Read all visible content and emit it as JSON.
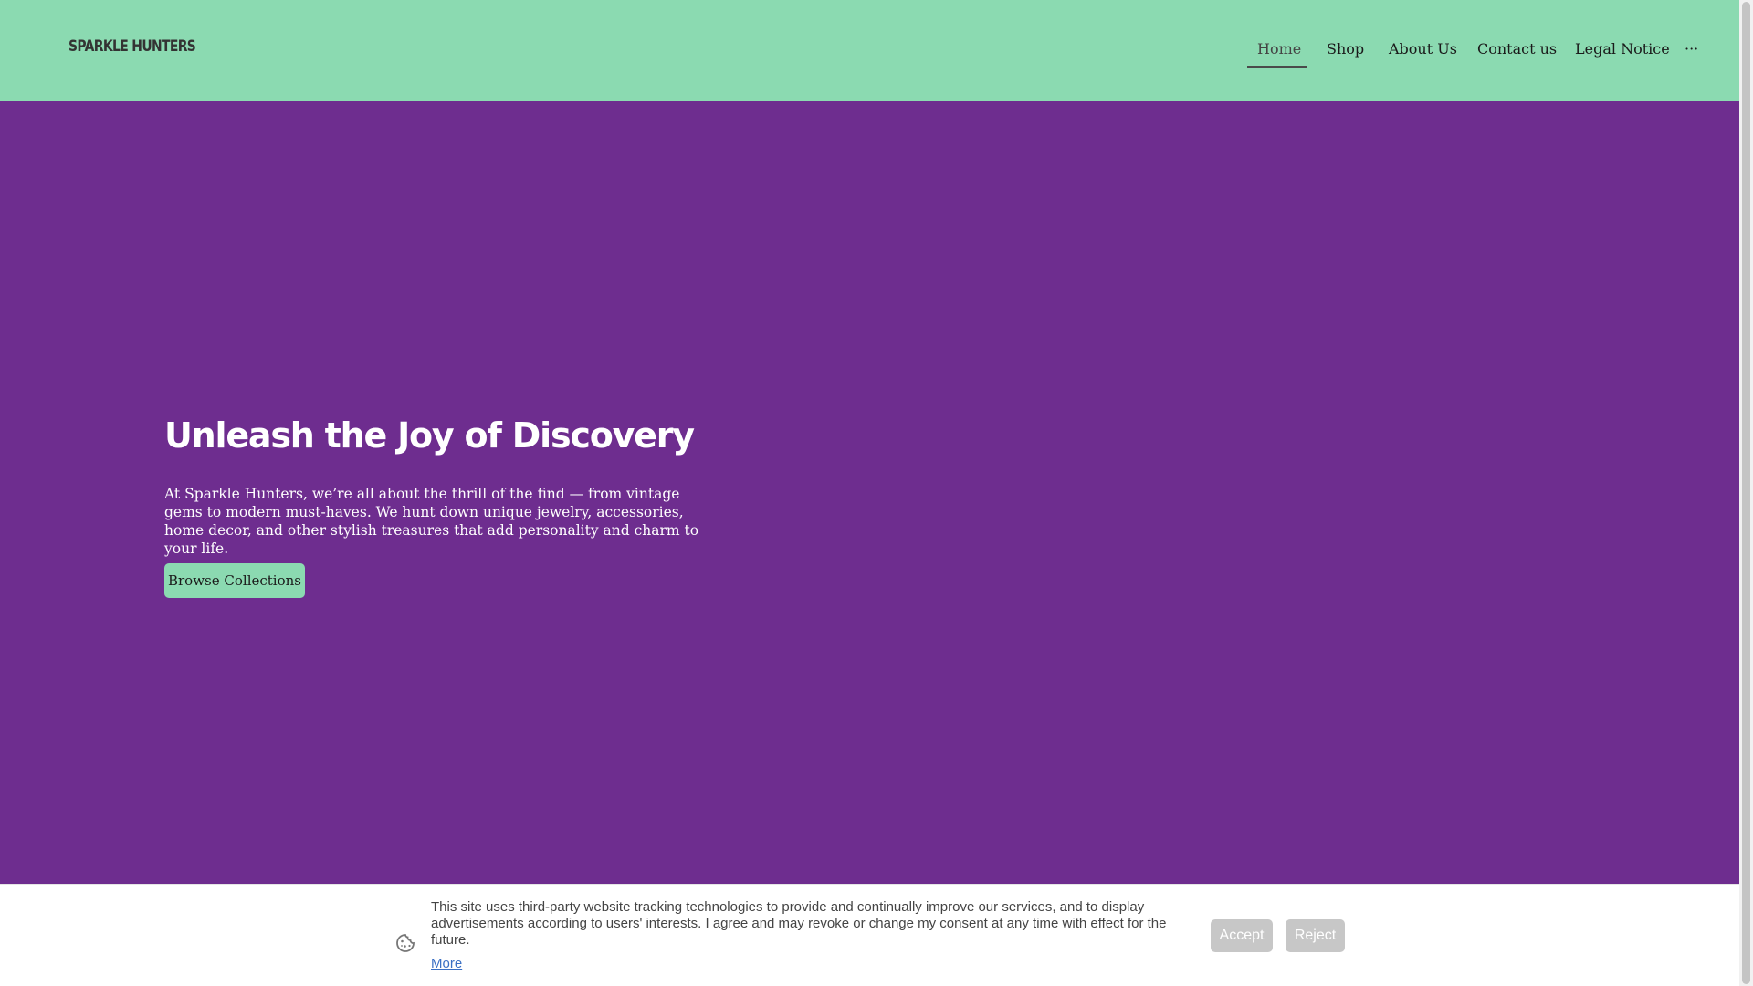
{
  "header": {
    "logo": "Sparkle Hunters",
    "nav": [
      {
        "label": "Home",
        "active": true
      },
      {
        "label": "Shop",
        "active": false
      },
      {
        "label": "About Us",
        "active": false
      },
      {
        "label": "Contact us",
        "active": false
      },
      {
        "label": "Legal Notice",
        "active": false
      },
      {
        "label": "···",
        "active": false
      }
    ]
  },
  "hero": {
    "title": "Unleash the Joy of Discovery",
    "text": "At Sparkle Hunters, we’re all about the thrill of the find — from vintage gems to modern must-haves. We hunt down unique jewelry, accessories, home decor, and other stylish treasures that add personality and charm to your life.",
    "button": "Browse Collections"
  },
  "cookie": {
    "icon": "cookie-icon",
    "text": "This site uses third-party website tracking technologies to provide and continually improve our services, and to display advertisements according to users' interests. I agree and may revoke or change my consent at any time with effect for the future.",
    "more": "More",
    "accept": "Accept",
    "reject": "Reject"
  },
  "colors": {
    "header_bg": "#8bdab1",
    "hero_bg": "#6e2d8f",
    "button_bg": "#8bdab1",
    "cookie_button_bg": "#c7c7c7",
    "link": "#3a6fc4"
  }
}
